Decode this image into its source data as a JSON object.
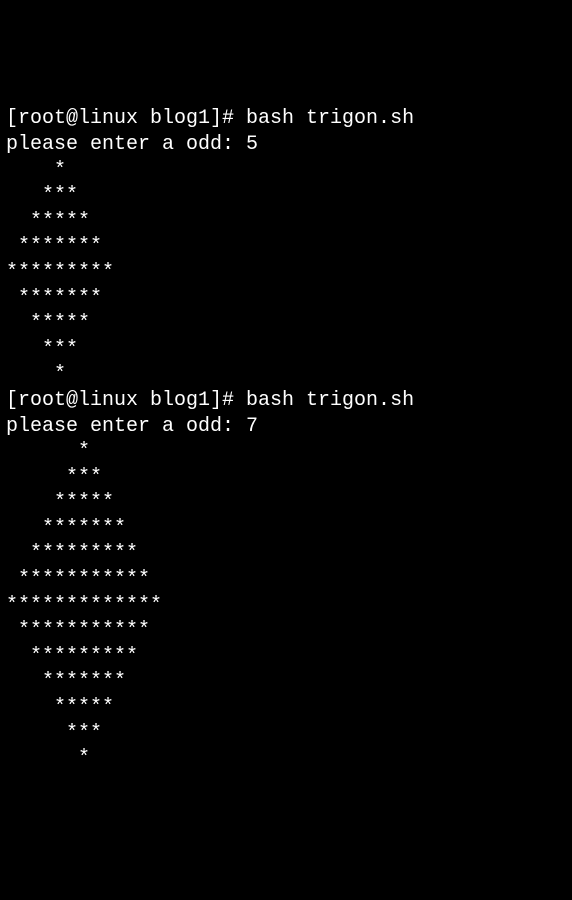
{
  "terminal": {
    "lines": [
      "[root@linux blog1]# bash trigon.sh",
      "please enter a odd: 5",
      "    *",
      "   ***",
      "  *****",
      " *******",
      "*********",
      " *******",
      "  *****",
      "   ***",
      "    *",
      "[root@linux blog1]# bash trigon.sh",
      "please enter a odd: 7",
      "      *",
      "     ***",
      "    *****",
      "   *******",
      "  *********",
      " ***********",
      "*************",
      " ***********",
      "  *********",
      "   *******",
      "    *****",
      "     ***",
      "      *"
    ]
  }
}
